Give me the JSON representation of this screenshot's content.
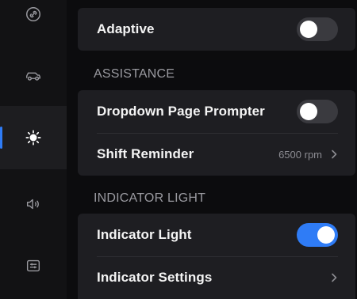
{
  "sidebar": {
    "items": [
      {
        "icon": "link-icon",
        "active": false
      },
      {
        "icon": "car-icon",
        "active": false
      },
      {
        "icon": "brightness-icon",
        "active": true
      },
      {
        "icon": "volume-icon",
        "active": false
      },
      {
        "icon": "settings-list-icon",
        "active": false
      }
    ]
  },
  "display": {
    "adaptive_label": "Adaptive",
    "adaptive_on": false
  },
  "assistance": {
    "section_title": "ASSISTANCE",
    "dropdown_prompter_label": "Dropdown Page Prompter",
    "dropdown_prompter_on": false,
    "shift_reminder_label": "Shift Reminder",
    "shift_reminder_value": "6500 rpm"
  },
  "indicator": {
    "section_title": "INDICATOR LIGHT",
    "indicator_light_label": "Indicator Light",
    "indicator_light_on": true,
    "indicator_settings_label": "Indicator Settings"
  },
  "colors": {
    "accent": "#2f7cf6",
    "background": "#0c0c0e",
    "card": "#1e1e22",
    "toggle_off": "#3a3a3f"
  }
}
